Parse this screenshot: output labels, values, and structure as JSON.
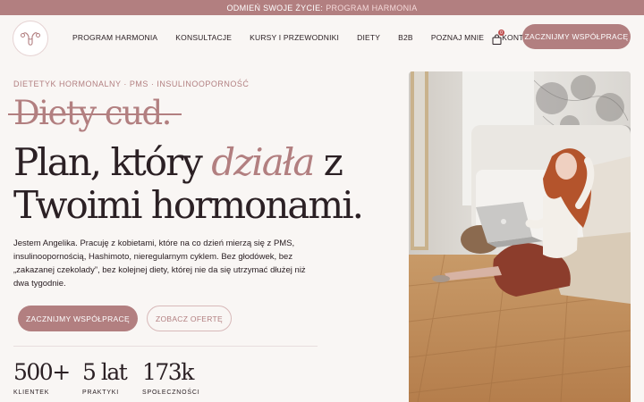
{
  "announcement": {
    "text": "ODMIEŃ SWOJE ŻYCIE:",
    "highlight": "PROGRAM HARMONIA"
  },
  "nav": {
    "items": [
      "PROGRAM HARMONIA",
      "KONSULTACJE",
      "KURSY I PRZEWODNIKI",
      "DIETY",
      "B2B",
      "POZNAJ MNIE",
      "KONTAKT"
    ],
    "cart_count": "0",
    "cta": "ZACZNIJMY WSPÓŁPRACĘ"
  },
  "hero": {
    "kicker": "DIETETYK HORMONALNY · PMS · INSULINOOPORNOŚĆ",
    "strike": "Diety cud.",
    "title_before": "Plan, który ",
    "title_em": "działa",
    "title_after": " z Twoimi hormonami.",
    "lead": "Jestem Angelika. Pracuję z kobietami, które na co dzień mierzą się z PMS, insulinoopornością, Hashimoto, nieregularnym cyklem. Bez głodówek, bez „zakazanej czekolady”, bez kolejnej diety, której nie da się utrzymać dłużej niż dwa tygodnie.",
    "primary_cta": "ZACZNIJMY WSPÓŁPRACĘ",
    "secondary_cta": "ZOBACZ OFERTĘ"
  },
  "stats": [
    {
      "value": "500+",
      "label": "KLIENTEK"
    },
    {
      "value": "5 lat",
      "label": "PRAKTYKI"
    },
    {
      "value": "173k",
      "label": "SPOŁECZNOŚCI"
    }
  ],
  "colors": {
    "accent": "#b27f80",
    "text": "#2b2024",
    "background": "#f9f6f4"
  },
  "icons": [
    "uterus-logo-icon",
    "shopping-bag-icon"
  ]
}
